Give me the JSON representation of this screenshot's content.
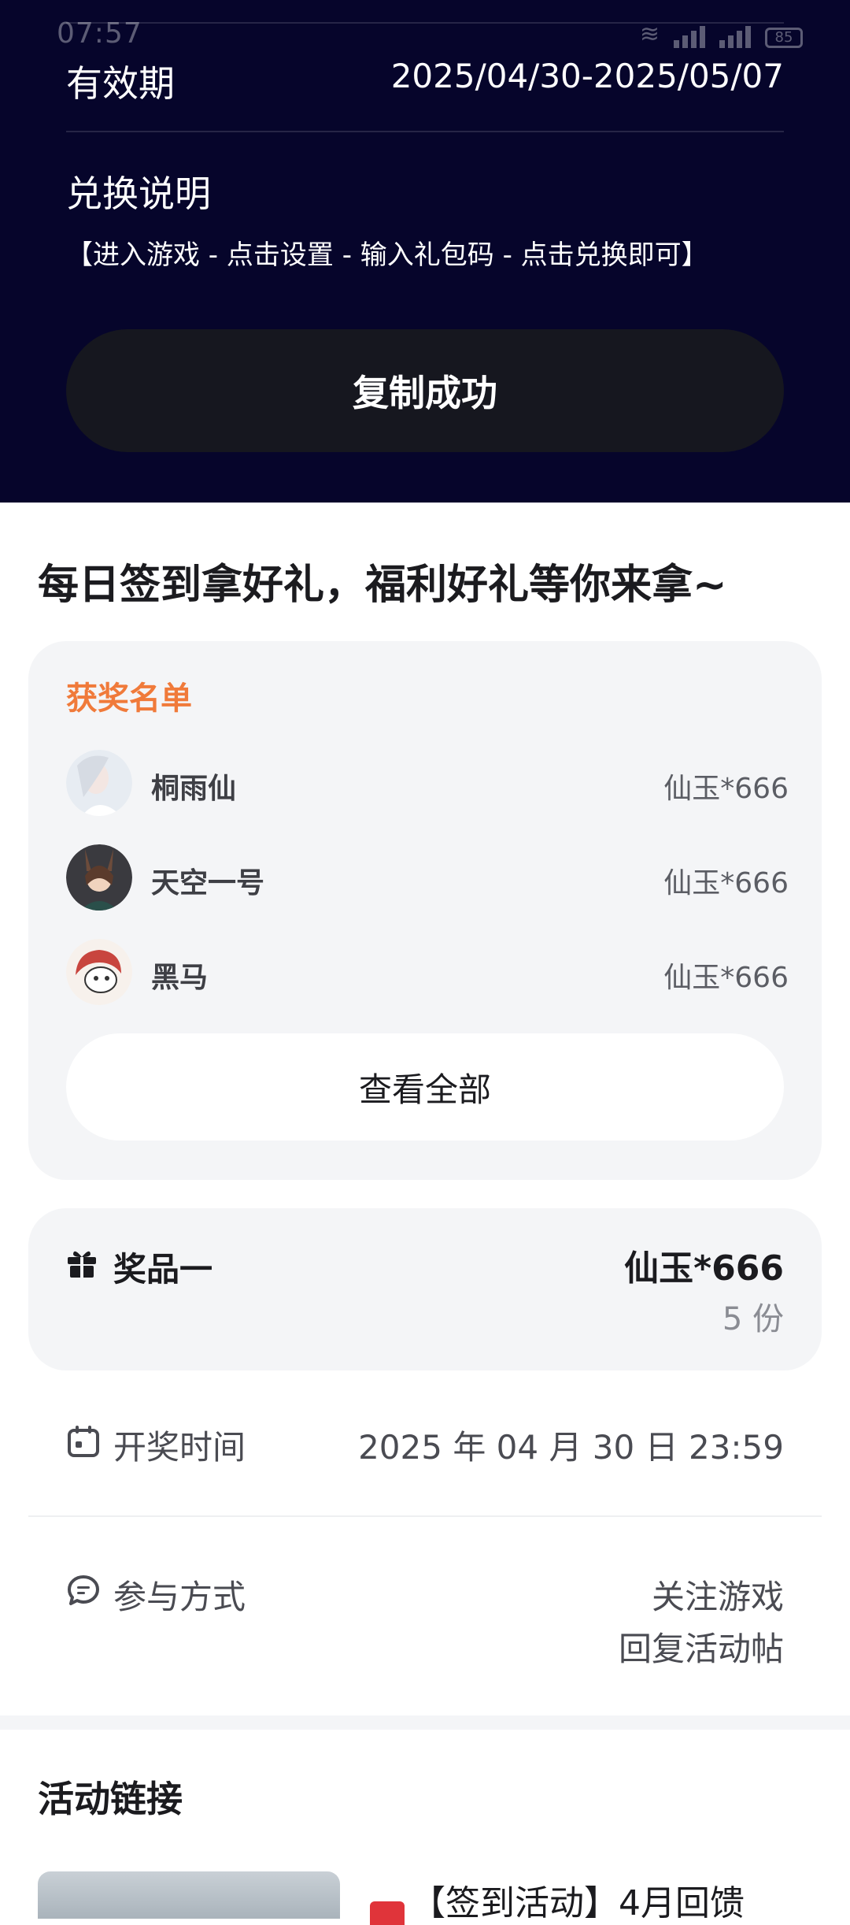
{
  "status_bar": {
    "time": "07:57",
    "battery": "85"
  },
  "code_panel": {
    "validity_label": "有效期",
    "validity_value": "2025/04/30-2025/05/07",
    "redeem_title": "兑换说明",
    "redeem_desc": "【进入游戏 - 点击设置 - 输入礼包码 - 点击兑换即可】",
    "copy_button": "复制成功"
  },
  "headline": "每日签到拿好礼，福利好礼等你来拿~",
  "winners": {
    "title": "获奖名单",
    "items": [
      {
        "name": "桐雨仙",
        "prize": "仙玉*666"
      },
      {
        "name": "天空一号",
        "prize": "仙玉*666"
      },
      {
        "name": "黑马",
        "prize": "仙玉*666"
      }
    ],
    "view_all": "查看全部"
  },
  "prize": {
    "label": "奖品一",
    "value": "仙玉*666",
    "count": "5 份"
  },
  "draw_time": {
    "label": "开奖时间",
    "value": "2025 年 04 月 30 日 23:59"
  },
  "participation": {
    "label": "参与方式",
    "line1": "关注游戏",
    "line2": "回复活动帖"
  },
  "activity_links": {
    "title": "活动链接",
    "first_item_title": "【签到活动】4月回馈"
  },
  "colors": {
    "panel_bg": "#06052b",
    "accent_orange": "#f07a3a",
    "card_bg": "#f4f5f7"
  }
}
